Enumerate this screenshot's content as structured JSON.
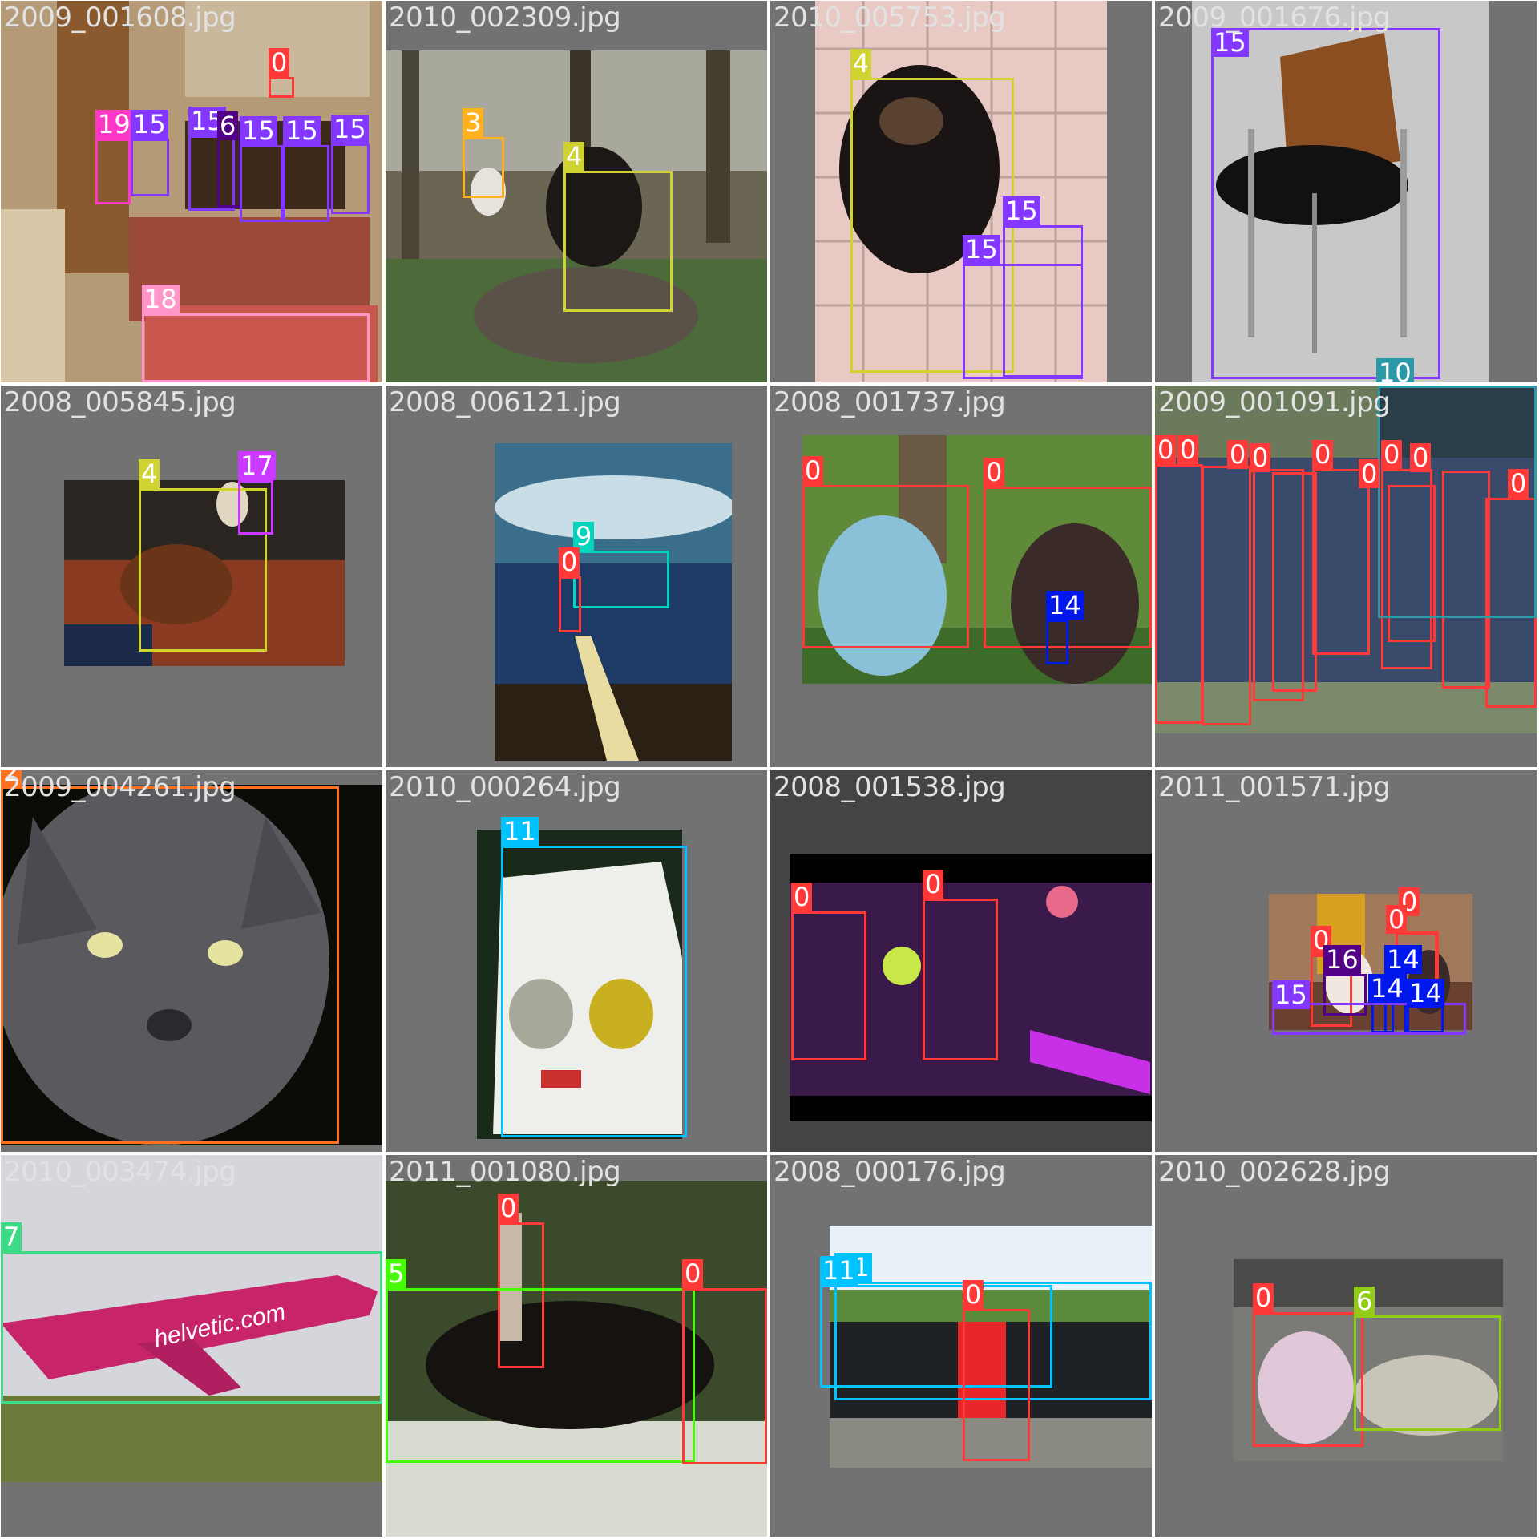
{
  "grid": {
    "tiles": [
      {
        "filename": "2009_001608.jpg",
        "scene": "indoor dining room with chairs and sofa",
        "objects": [
          {
            "class_id": "0"
          },
          {
            "class_id": "19"
          },
          {
            "class_id": "15"
          },
          {
            "class_id": "15"
          },
          {
            "class_id": "6"
          },
          {
            "class_id": "15"
          },
          {
            "class_id": "15"
          },
          {
            "class_id": "15"
          },
          {
            "class_id": "18"
          }
        ]
      },
      {
        "filename": "2010_002309.jpg",
        "scene": "black dog sitting on tree stump in forest",
        "objects": [
          {
            "class_id": "3"
          },
          {
            "class_id": "4"
          }
        ]
      },
      {
        "filename": "2010_005753.jpg",
        "scene": "dog on paved patio",
        "objects": [
          {
            "class_id": "4"
          },
          {
            "class_id": "15"
          },
          {
            "class_id": "15"
          }
        ]
      },
      {
        "filename": "2009_001676.jpg",
        "scene": "chair on grey background",
        "objects": [
          {
            "class_id": "15"
          },
          {
            "class_id": "10"
          }
        ]
      },
      {
        "filename": "2008_005845.jpg",
        "scene": "dog on rug",
        "objects": [
          {
            "class_id": "4"
          },
          {
            "class_id": "17"
          }
        ]
      },
      {
        "filename": "2008_006121.jpg",
        "scene": "boat on lake under cloudy sky",
        "objects": [
          {
            "class_id": "9"
          },
          {
            "class_id": "0"
          }
        ]
      },
      {
        "filename": "2008_001737.jpg",
        "scene": "two women laughing outdoors",
        "objects": [
          {
            "class_id": "0"
          },
          {
            "class_id": "0"
          },
          {
            "class_id": "14"
          }
        ]
      },
      {
        "filename": "2009_001091.jpg",
        "scene": "group of young people in front of bus",
        "objects": [
          {
            "class_id": "0"
          },
          {
            "class_id": "0"
          },
          {
            "class_id": "0"
          },
          {
            "class_id": "0"
          },
          {
            "class_id": "0"
          },
          {
            "class_id": "0"
          },
          {
            "class_id": "0"
          },
          {
            "class_id": "0"
          },
          {
            "class_id": "0"
          },
          {
            "class_id": "10"
          }
        ]
      },
      {
        "filename": "2009_004261.jpg",
        "scene": "grey cat close up",
        "objects": [
          {
            "class_id": "2"
          }
        ]
      },
      {
        "filename": "2010_000264.jpg",
        "scene": "white vintage car front",
        "objects": [
          {
            "class_id": "11"
          }
        ]
      },
      {
        "filename": "2008_001538.jpg",
        "scene": "band on stage with purple lights",
        "objects": [
          {
            "class_id": "0"
          },
          {
            "class_id": "0"
          }
        ]
      },
      {
        "filename": "2011_001571.jpg",
        "scene": "people at a table",
        "objects": [
          {
            "class_id": "0"
          },
          {
            "class_id": "0"
          },
          {
            "class_id": "0"
          },
          {
            "class_id": "16"
          },
          {
            "class_id": "14"
          },
          {
            "class_id": "14"
          },
          {
            "class_id": "14"
          },
          {
            "class_id": "15"
          }
        ]
      },
      {
        "filename": "2010_003474.jpg",
        "scene": "pink helvetic airplane taking off",
        "objects": [
          {
            "class_id": "7"
          }
        ]
      },
      {
        "filename": "2011_001080.jpg",
        "scene": "child riding a black horse",
        "objects": [
          {
            "class_id": "0"
          },
          {
            "class_id": "5"
          },
          {
            "class_id": "0"
          }
        ]
      },
      {
        "filename": "2008_000176.jpg",
        "scene": "man standing in front of limousine",
        "objects": [
          {
            "class_id": "11"
          },
          {
            "class_id": "11"
          },
          {
            "class_id": "0"
          }
        ]
      },
      {
        "filename": "2010_002628.jpg",
        "scene": "child petting sheep by fence",
        "objects": [
          {
            "class_id": "0"
          },
          {
            "class_id": "6"
          }
        ]
      }
    ]
  },
  "airplane_livery": "helvetic.com",
  "colors": {
    "0": "#ff3838",
    "2": "#ff701f",
    "3": "#ffb21d",
    "4": "#cfd231",
    "5": "#48f90a",
    "6": "#92cc17",
    "7": "#3ddb86",
    "9": "#00d4bb",
    "10": "#2c99a8",
    "11": "#00c2ff",
    "14": "#0018ec",
    "15": "#8438ff",
    "16": "#520085",
    "17": "#cb38ff",
    "18": "#ff95c8",
    "19": "#ff37c7"
  }
}
